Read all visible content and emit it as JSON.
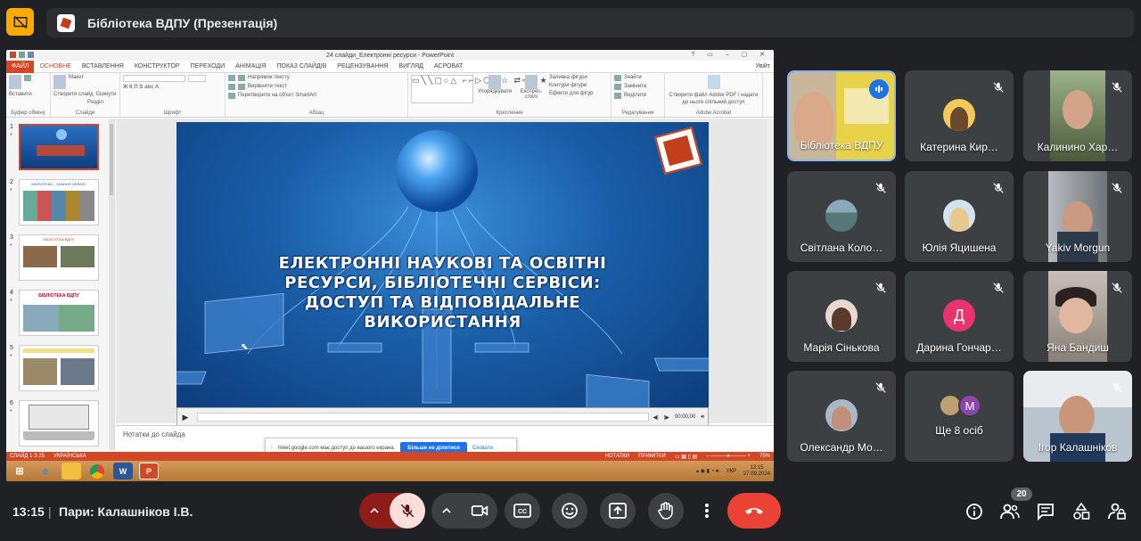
{
  "header": {
    "title": "Бібліотека ВДПУ (Презентація)"
  },
  "powerpoint": {
    "window_title": "24 слайди_Електронні ресурси - PowerPoint",
    "file_tab": "ФАЙЛ",
    "tabs": [
      "ОСНОВНЕ",
      "ВСТАВЛЕННЯ",
      "КОНСТРУКТОР",
      "ПЕРЕХОДИ",
      "АНІМАЦІЯ",
      "ПОКАЗ СЛАЙДІВ",
      "РЕЦЕНЗУВАННЯ",
      "ВИГЛЯД",
      "АСРОВАТ"
    ],
    "account": "Увійт",
    "ribbon": {
      "paste": "Вставити",
      "clipboard": "Буфер обміну",
      "new_slide": "Створити слайд",
      "layout": "Макет",
      "reset": "Скинути",
      "section": "Розділ",
      "slides": "Слайди",
      "font": "Шрифт",
      "text_direction": "Напрямок тексту",
      "align_text": "Вирівняти текст",
      "smartart": "Перетворити на об'єкт SmartArt",
      "paragraph": "Абзац",
      "arrange": "Упорядкувати",
      "quick_styles": "Експрес-стилі",
      "shape_fill": "Заливка фігури",
      "shape_outline": "Контури фігури",
      "shape_effects": "Ефекти для фігур",
      "drawing": "Креслення",
      "find": "Знайти",
      "replace": "Замінити",
      "select": "Виділити",
      "editing": "Редагування",
      "adobe_pdf": "Створити файл Adobe PDF і надати до нього спільний доступ",
      "adobe_acrobat": "Adobe Acrobat"
    },
    "thumbnails": [
      {
        "num": "1",
        "title": ""
      },
      {
        "num": "2",
        "title": "БІБЛІОТЕКА – ЗНАННЯ ОБРАЗУ"
      },
      {
        "num": "3",
        "title": "БІБЛІОТЕКА ВДПУ"
      },
      {
        "num": "4",
        "title": "БІБЛІОТЕКА ВДПУ"
      },
      {
        "num": "5",
        "title": ""
      },
      {
        "num": "6",
        "title": ""
      }
    ],
    "slide_title": "ЕЛЕКТРОННІ НАУКОВІ ТА ОСВІТНІ РЕСУРСИ, БІБЛІОТЕЧНІ СЕРВІСИ: ДОСТУП ТА ВІДПОВІДАЛЬНЕ ВИКОРИСТАННЯ",
    "media_time": "00:00,00",
    "notes_placeholder": "Нотатки до слайда",
    "status_slide": "СЛАЙД 1 З 25",
    "status_lang": "УКРАЇНСЬКА",
    "status_notes": "НОТАТКИ",
    "status_comments": "ПРИМІТКИ",
    "zoom": "75%",
    "share_popup": {
      "text": "meet.google.com має доступ до вашого екрана.",
      "stop": "Більше не ділитися",
      "hide": "Сховати"
    },
    "taskbar": {
      "lang": "УКР",
      "time": "13:15",
      "date": "27.09.2024"
    }
  },
  "participants": [
    {
      "name": "Бібліотека ВДПУ",
      "speaking": true
    },
    {
      "name": "Катерина Кир…",
      "muted": true
    },
    {
      "name": "Калинино Хар…",
      "muted": true
    },
    {
      "name": "Світлана Коло…",
      "muted": true
    },
    {
      "name": "Юлія Яцишена",
      "muted": true
    },
    {
      "name": "Yakiv Morgun",
      "muted": true
    },
    {
      "name": "Марія Сінькова",
      "muted": true
    },
    {
      "name": "Дарина Гончар…",
      "muted": true,
      "initial": "Д"
    },
    {
      "name": "Яна Бандиш",
      "muted": true
    },
    {
      "name": "Олександр Мо…",
      "muted": true
    },
    {
      "name": "Ще 8 осіб",
      "initial": "М"
    },
    {
      "name": "Ігор Калашніков",
      "muted": true
    }
  ],
  "bottom": {
    "time": "13:15",
    "meeting": "Пари: Калашніков І.В.",
    "participant_count": "20"
  },
  "colors": {
    "accent": "#8ab4f8",
    "end_call": "#ea4335",
    "mic_off": "#f9dedc",
    "powerpoint": "#d24726"
  }
}
